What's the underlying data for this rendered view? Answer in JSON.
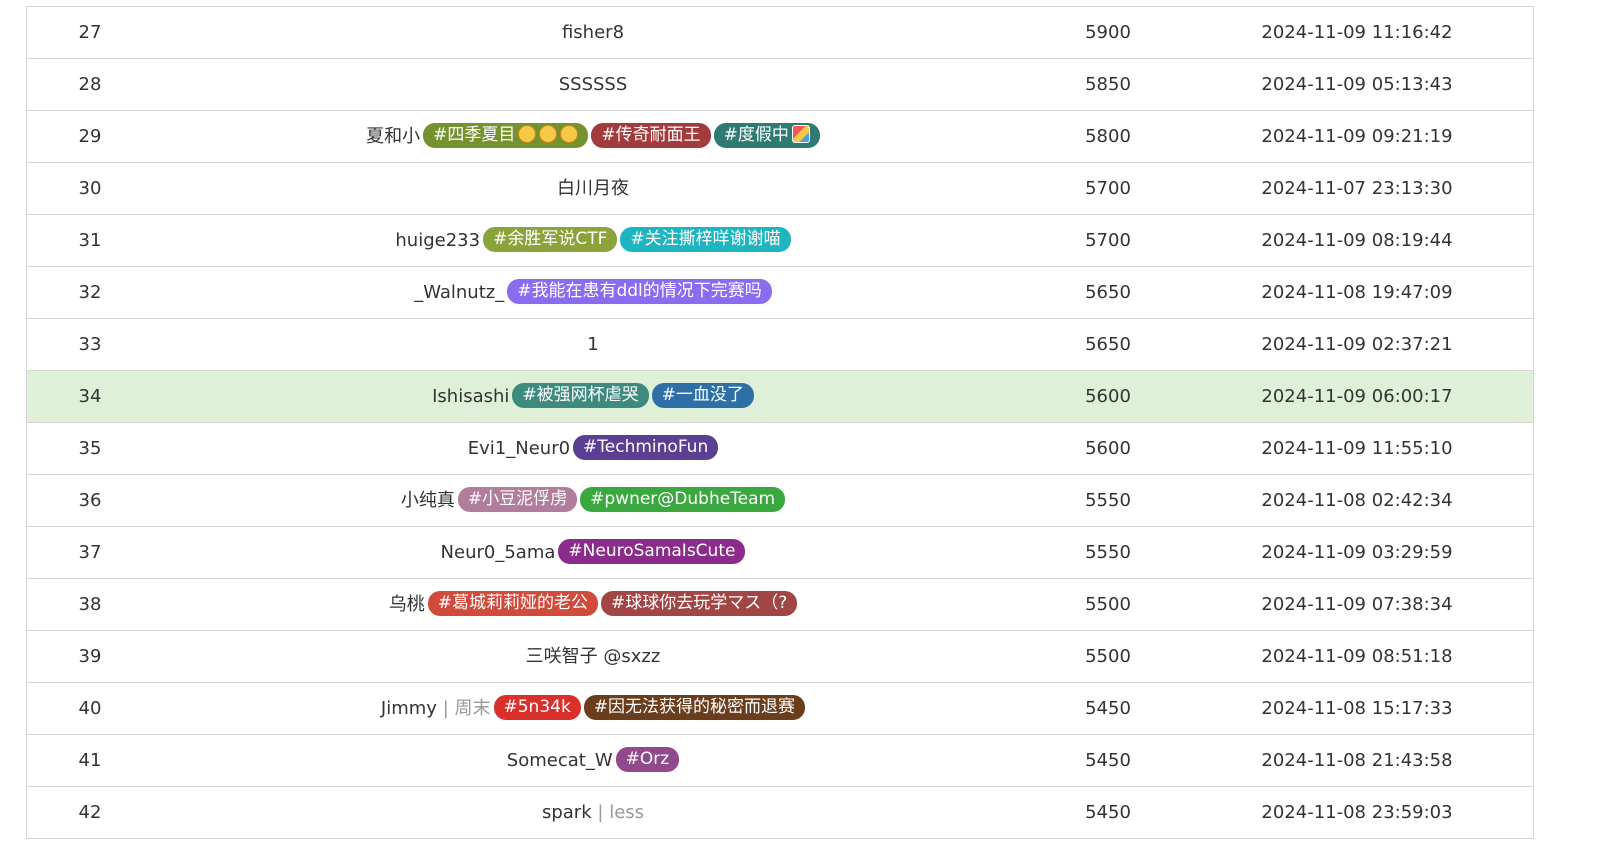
{
  "rows": [
    {
      "rank": "27",
      "name": "fisher8",
      "sep": "",
      "subtitle": "",
      "tags": [],
      "score": "5900",
      "time": "2024-11-09 11:16:42",
      "highlight": false
    },
    {
      "rank": "28",
      "name": "SSSSSS",
      "sep": "",
      "subtitle": "",
      "tags": [],
      "score": "5850",
      "time": "2024-11-09 05:13:43",
      "highlight": false
    },
    {
      "rank": "29",
      "name": "夏和小",
      "sep": "",
      "subtitle": "",
      "tags": [
        {
          "label": "#四季夏目",
          "color": "#76922f",
          "emoji": [
            "smile-icon",
            "smile-icon",
            "smile-icon"
          ]
        },
        {
          "label": "#传奇耐面王",
          "color": "#a23b3b",
          "emoji": []
        },
        {
          "label": "#度假中",
          "color": "#2f7b73",
          "emoji": [
            "beach-icon"
          ]
        }
      ],
      "score": "5800",
      "time": "2024-11-09 09:21:19",
      "highlight": false
    },
    {
      "rank": "30",
      "name": "白川月夜",
      "sep": "",
      "subtitle": "",
      "tags": [],
      "score": "5700",
      "time": "2024-11-07 23:13:30",
      "highlight": false
    },
    {
      "rank": "31",
      "name": "huige233",
      "sep": "",
      "subtitle": "",
      "tags": [
        {
          "label": "#余胜军说CTF",
          "color": "#8aa33a",
          "emoji": []
        },
        {
          "label": "#关注撕梓咩谢谢喵",
          "color": "#1fb5c0",
          "emoji": []
        }
      ],
      "score": "5700",
      "time": "2024-11-09 08:19:44",
      "highlight": false
    },
    {
      "rank": "32",
      "name": "_Walnutz_",
      "sep": "",
      "subtitle": "",
      "tags": [
        {
          "label": "#我能在患有ddl的情况下完赛吗",
          "color": "#8b6cf0",
          "emoji": []
        }
      ],
      "score": "5650",
      "time": "2024-11-08 19:47:09",
      "highlight": false
    },
    {
      "rank": "33",
      "name": "1",
      "sep": "",
      "subtitle": "",
      "tags": [],
      "score": "5650",
      "time": "2024-11-09 02:37:21",
      "highlight": false
    },
    {
      "rank": "34",
      "name": "Ishisashi",
      "sep": "",
      "subtitle": "",
      "tags": [
        {
          "label": "#被强网杯虐哭",
          "color": "#3e8a7e",
          "emoji": []
        },
        {
          "label": "#一血没了",
          "color": "#2e6fa6",
          "emoji": []
        }
      ],
      "score": "5600",
      "time": "2024-11-09 06:00:17",
      "highlight": true
    },
    {
      "rank": "35",
      "name": "Evi1_Neur0",
      "sep": "",
      "subtitle": "",
      "tags": [
        {
          "label": "#TechminoFun",
          "color": "#5b3f93",
          "emoji": []
        }
      ],
      "score": "5600",
      "time": "2024-11-09 11:55:10",
      "highlight": false
    },
    {
      "rank": "36",
      "name": "小纯真",
      "sep": "",
      "subtitle": "",
      "tags": [
        {
          "label": "#小豆泥俘虏",
          "color": "#b07d9c",
          "emoji": []
        },
        {
          "label": "#pwner@DubheTeam",
          "color": "#3aa83e",
          "emoji": []
        }
      ],
      "score": "5550",
      "time": "2024-11-08 02:42:34",
      "highlight": false
    },
    {
      "rank": "37",
      "name": "Neur0_5ama",
      "sep": "",
      "subtitle": "",
      "tags": [
        {
          "label": "#NeuroSamaIsCute",
          "color": "#8b2b8a",
          "emoji": []
        }
      ],
      "score": "5550",
      "time": "2024-11-09 03:29:59",
      "highlight": false
    },
    {
      "rank": "38",
      "name": "乌桃",
      "sep": "",
      "subtitle": "",
      "tags": [
        {
          "label": "#葛城莉莉娅的老公",
          "color": "#d04b3b",
          "emoji": []
        },
        {
          "label": "#球球你去玩学マス（?",
          "color": "#a24545",
          "emoji": []
        }
      ],
      "score": "5500",
      "time": "2024-11-09 07:38:34",
      "highlight": false
    },
    {
      "rank": "39",
      "name": "三咲智子 @sxzz",
      "sep": "",
      "subtitle": "",
      "tags": [],
      "score": "5500",
      "time": "2024-11-09 08:51:18",
      "highlight": false
    },
    {
      "rank": "40",
      "name": "Jimmy",
      "sep": "|",
      "subtitle": "周末",
      "tags": [
        {
          "label": "#5n34k",
          "color": "#d9302c",
          "emoji": []
        },
        {
          "label": "#因无法获得的秘密而退赛",
          "color": "#6a3d1d",
          "emoji": []
        }
      ],
      "score": "5450",
      "time": "2024-11-08 15:17:33",
      "highlight": false
    },
    {
      "rank": "41",
      "name": "Somecat_W",
      "sep": "",
      "subtitle": "",
      "tags": [
        {
          "label": "#Orz",
          "color": "#8e4a8a",
          "emoji": []
        }
      ],
      "score": "5450",
      "time": "2024-11-08 21:43:58",
      "highlight": false
    },
    {
      "rank": "42",
      "name": "spark",
      "sep": "|",
      "subtitle": "less",
      "tags": [],
      "score": "5450",
      "time": "2024-11-08 23:59:03",
      "highlight": false
    }
  ]
}
